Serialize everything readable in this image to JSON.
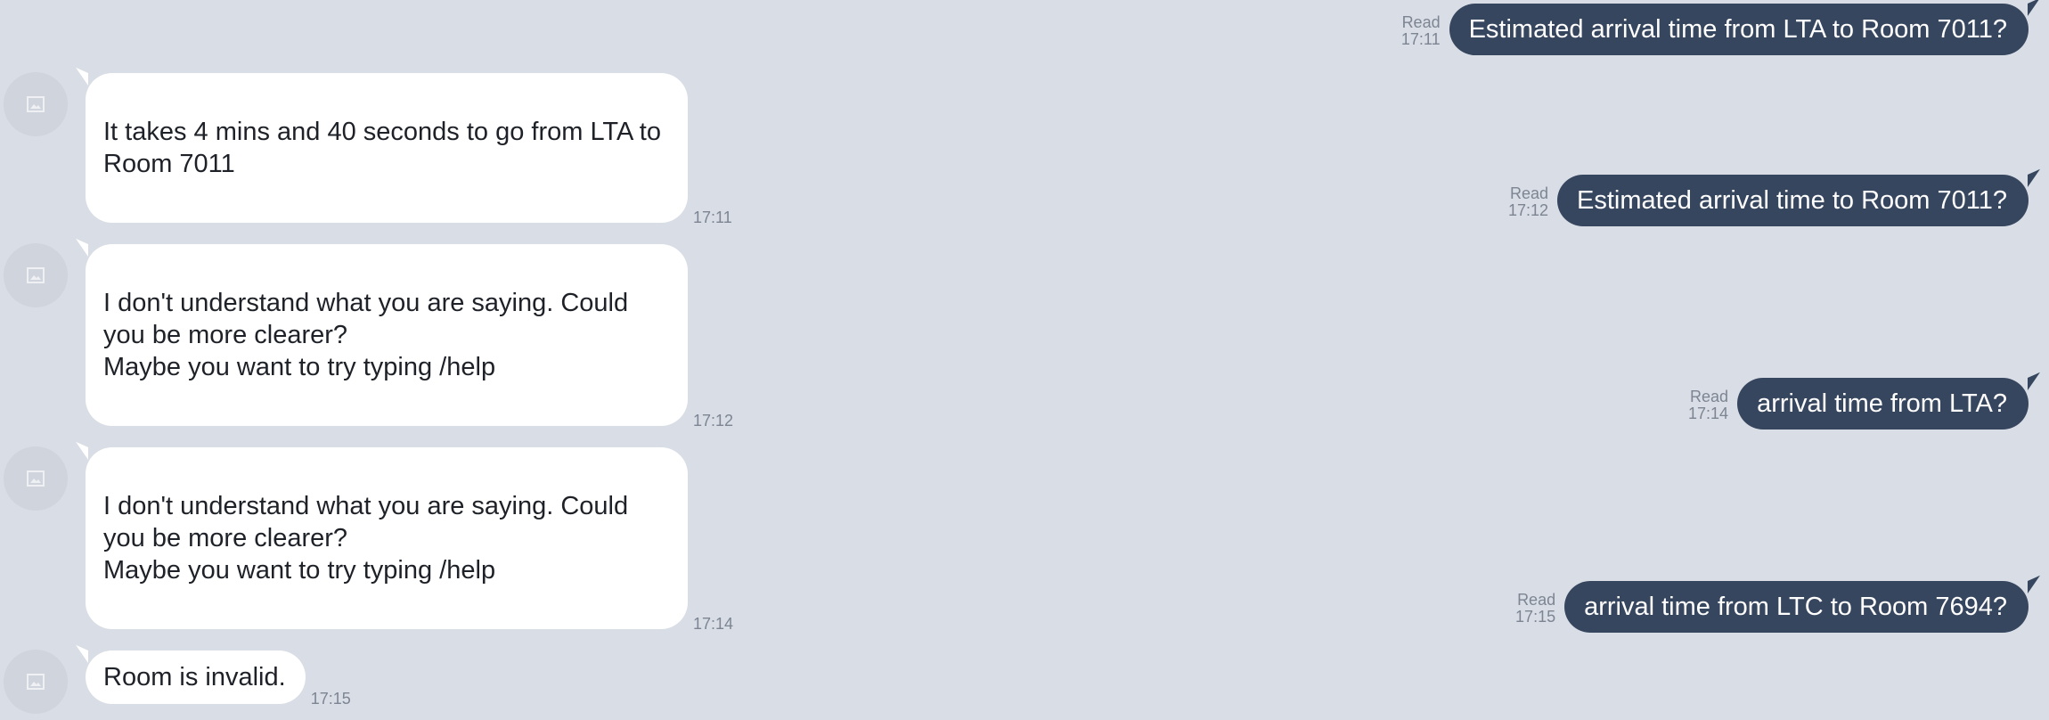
{
  "messages": [
    {
      "direction": "out",
      "text": "Estimated arrival time from LTA to Room 7011?",
      "status": "Read",
      "time": "17:11"
    },
    {
      "direction": "in",
      "text": "It takes 4 mins and 40 seconds to go from LTA to Room 7011",
      "time": "17:11"
    },
    {
      "direction": "out",
      "text": "Estimated arrival time to Room 7011?",
      "status": "Read",
      "time": "17:12"
    },
    {
      "direction": "in",
      "text": "I don't understand what you are saying. Could you be more clearer?\nMaybe you want to try typing /help",
      "time": "17:12"
    },
    {
      "direction": "out",
      "text": "arrival time from LTA?",
      "status": "Read",
      "time": "17:14"
    },
    {
      "direction": "in",
      "text": "I don't understand what you are saying. Could you be more clearer?\nMaybe you want to try typing /help",
      "time": "17:14"
    },
    {
      "direction": "out",
      "text": "arrival time from LTC to Room 7694?",
      "status": "Read",
      "time": "17:15"
    },
    {
      "direction": "in",
      "text": "Room is invalid.",
      "time": "17:15"
    }
  ],
  "icons": {
    "avatar": "image-placeholder-icon"
  },
  "colors": {
    "background": "#d9dde5",
    "outgoing_bubble": "#37465f",
    "incoming_bubble": "#ffffff",
    "meta_text": "#7d8593"
  }
}
